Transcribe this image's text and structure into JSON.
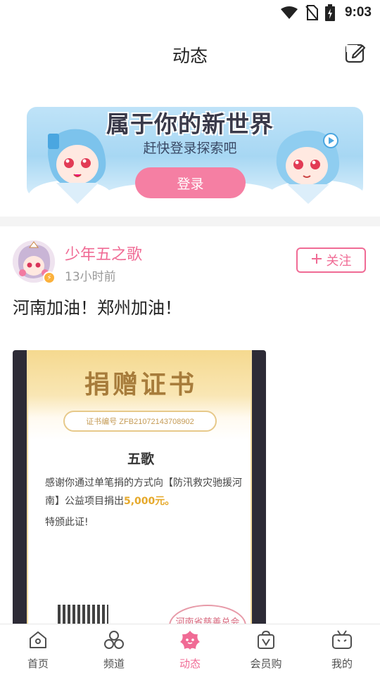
{
  "status_bar": {
    "time": "9:03",
    "icons": [
      "wifi-icon",
      "no-sim-icon",
      "battery-charging-icon"
    ]
  },
  "header": {
    "title": "动态",
    "compose_icon": "edit-icon"
  },
  "banner": {
    "title": "属于你的新世界",
    "subtitle": "赶快登录探索吧",
    "login_label": "登录",
    "accent_color": "#f57fa3"
  },
  "post": {
    "username": "少年五之歌",
    "time": "13小时前",
    "follow_label": "关注",
    "text": "河南加油！郑州加油！",
    "accent_color": "#f06b95",
    "certificate": {
      "title": "捐赠证书",
      "number": "证书编号 ZFB21072143708902",
      "name": "五歌",
      "body_prefix": "感谢你通过单笔捐的方式向【防汛救灾驰援河南】公益项目捐出",
      "amount": "5,000元。",
      "closing": "特颁此证!",
      "stamp_text": "河南省慈善总会"
    }
  },
  "bottom_nav": {
    "items": [
      {
        "label": "首页",
        "icon": "home-icon",
        "active": false
      },
      {
        "label": "频道",
        "icon": "channels-icon",
        "active": false
      },
      {
        "label": "动态",
        "icon": "dynamic-icon",
        "active": true
      },
      {
        "label": "会员购",
        "icon": "shopping-bag-icon",
        "active": false
      },
      {
        "label": "我的",
        "icon": "tv-icon",
        "active": false
      }
    ]
  }
}
